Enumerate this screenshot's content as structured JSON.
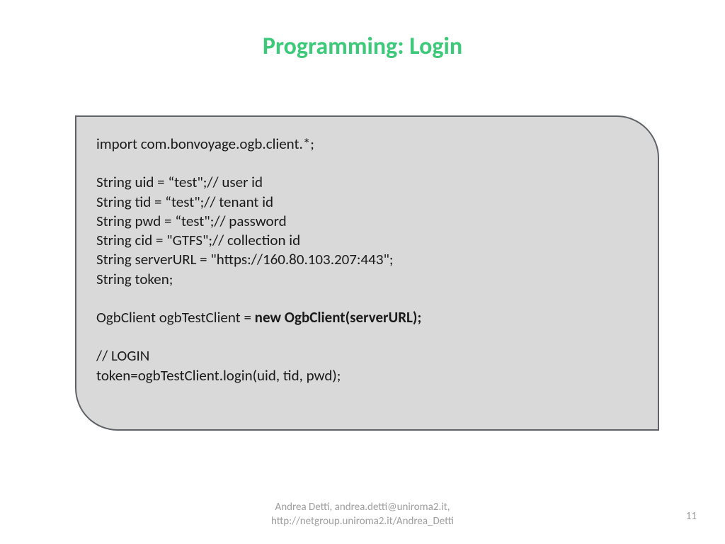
{
  "title": "Programming: Login",
  "code": {
    "l1": "import com.bonvoyage.ogb.client.*;",
    "l2": "String uid = “test\";// user id",
    "l3": "String tid = “test\";// tenant id",
    "l4": "String pwd = “test\";// password",
    "l5": "String cid = \"GTFS\";// collection id",
    "l6": "String serverURL = \"https://160.80.103.207:443\";",
    "l7": "String token;",
    "l8_a": "OgbClient ogbTestClient = ",
    "l8_b": "new OgbClient(serverURL);",
    "l9": "// LOGIN",
    "l10": "token=ogbTestClient.login(uid, tid, pwd);"
  },
  "footer": {
    "line1": "Andrea Detti, andrea.detti@uniroma2.it,",
    "line2": "http://netgroup.uniroma2.it/Andrea_Detti"
  },
  "page_number": "11"
}
